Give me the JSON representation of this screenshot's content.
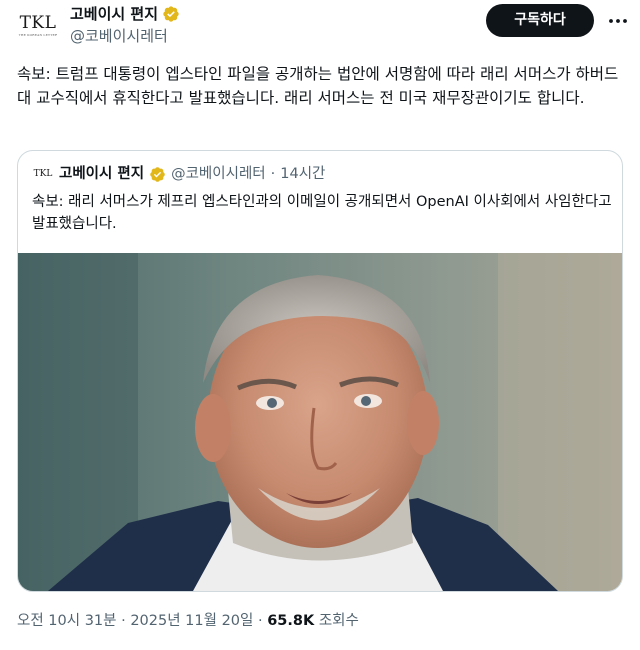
{
  "author": {
    "avatar_text": "TKL",
    "avatar_sub": "THE KOREAN LETTER",
    "display_name": "고베이시 편지",
    "handle": "@코베이시레터"
  },
  "subscribe_label": "구독하다",
  "tweet": {
    "text": "속보: 트럼프 대통령이 엡스타인 파일을 공개하는 법안에 서명함에 따라 래리 서머스가 하버드대 교수직에서 휴직한다고 발표했습니다. 래리 서머스는 전 미국 재무장관이기도 합니다."
  },
  "quote": {
    "avatar_text": "TKL",
    "display_name": "고베이시 편지",
    "handle": "@코베이시레터",
    "separator": "·",
    "time": "14시간",
    "text": "속보: 래리 서머스가 제프리 엡스타인과의 이메일이 공개되면서 OpenAI 이사회에서 사임한다고 발표했습니다."
  },
  "meta": {
    "time": "오전 10시 31분",
    "separator": "·",
    "date": "2025년 11월 20일",
    "views_count": "65.8K",
    "views_label": "조회수"
  },
  "colors": {
    "text": "#0f1419",
    "secondary": "#536471",
    "verified_gold": "#e2b719",
    "button_bg": "#0f1419",
    "border": "#cfd9de"
  },
  "icons": {
    "verified": "verified-gold-badge-icon",
    "more": "more-horizontal-icon"
  }
}
